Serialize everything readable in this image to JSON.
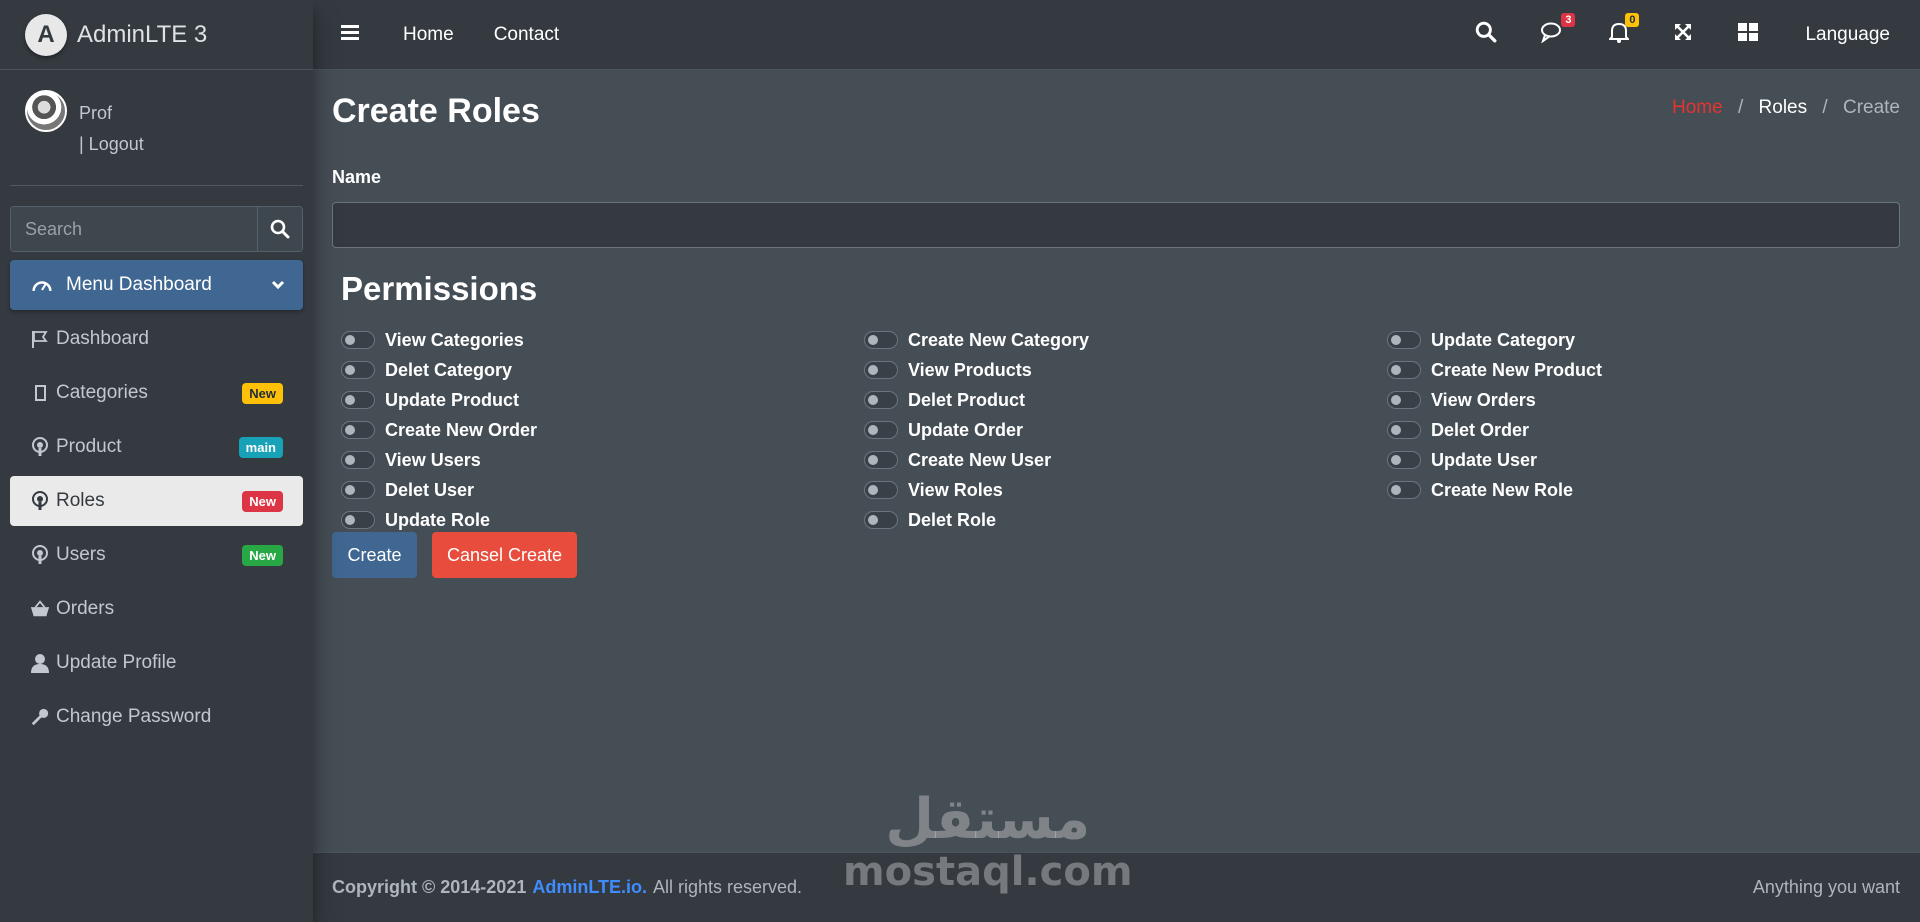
{
  "brand": {
    "logo_letter": "A",
    "name": "AdminLTE 3"
  },
  "user": {
    "name": "Prof",
    "logout": "| Logout"
  },
  "search": {
    "placeholder": "Search"
  },
  "sidebar": {
    "header": {
      "label": "Menu Dashboard",
      "icon": "tachometer-icon"
    },
    "items": [
      {
        "label": "Dashboard",
        "icon": "flag-icon"
      },
      {
        "label": "Categories",
        "icon": "square-icon",
        "badge": "New",
        "badge_color": "#ffc107"
      },
      {
        "label": "Product",
        "icon": "podcast-icon",
        "badge": "main",
        "badge_color": "#17a2b8"
      },
      {
        "label": "Roles",
        "icon": "podcast-icon",
        "badge": "New",
        "badge_color": "#dc3545",
        "active": true
      },
      {
        "label": "Users",
        "icon": "podcast-icon",
        "badge": "New",
        "badge_color": "#28a745"
      },
      {
        "label": "Orders",
        "icon": "basket-icon"
      },
      {
        "label": "Update Profile",
        "icon": "user-icon"
      },
      {
        "label": "Change Password",
        "icon": "key-icon"
      }
    ]
  },
  "topbar": {
    "links": [
      "Home",
      "Contact"
    ],
    "messages_count": "3",
    "notifications_count": "0",
    "language": "Language"
  },
  "page": {
    "title": "Create Roles",
    "breadcrumb": [
      "Home",
      "Roles",
      "Create"
    ],
    "name_label": "Name",
    "name_value": "",
    "permissions_title": "Permissions",
    "permissions": [
      "View Categories",
      "Create New Category",
      "Update Category",
      "Delet Category",
      "View Products",
      "Create New Product",
      "Update Product",
      "Delet Product",
      "View Orders",
      "Create New Order",
      "Update Order",
      "Delet Order",
      "View Users",
      "Create New User",
      "Update User",
      "Delet User",
      "View Roles",
      "Create New Role",
      "Update Role",
      "Delet Role"
    ],
    "create_button": "Create",
    "cancel_button": "Cansel Create"
  },
  "footer": {
    "copyright": "Copyright © 2014-2021",
    "link": "AdminLTE.io.",
    "rights": "All rights reserved.",
    "right_text": "Anything you want"
  },
  "watermark": {
    "arabic": "مستقل",
    "latin": "mostaql.com"
  },
  "colors": {
    "primary": "#3f6791",
    "danger": "#e74c3c",
    "breadcrumb_home": "#e3342f",
    "footer_link": "#3f8cff"
  }
}
